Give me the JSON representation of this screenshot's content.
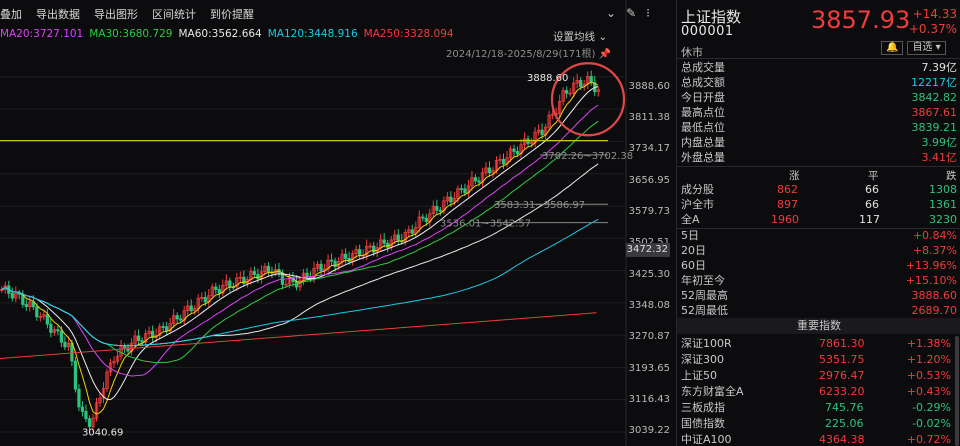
{
  "toolbar": {
    "items": [
      "叠加",
      "导出数据",
      "导出图形",
      "区间统计",
      "到价提醒"
    ]
  },
  "ma": [
    {
      "label": "MA20:3727.101",
      "color": "#e040fb"
    },
    {
      "label": "MA30:3680.729",
      "color": "#2ecc40"
    },
    {
      "label": "MA60:3562.664",
      "color": "#e8e8e8"
    },
    {
      "label": "MA120:3448.916",
      "color": "#1ec8e8"
    },
    {
      "label": "MA250:3328.094",
      "color": "#f03c3c"
    }
  ],
  "settings_label": "设置均线",
  "date_range": "2024/12/18-2025/8/29(171根)",
  "price_ticks": [
    "3888.60",
    "3811.38",
    "3734.17",
    "3656.95",
    "3579.73",
    "3502.51",
    "3425.30",
    "3348.08",
    "3270.87",
    "3193.65",
    "3116.43",
    "3039.22"
  ],
  "current_price_label": "3472.32",
  "annotations": {
    "high": "3888.60",
    "low": "3040.69",
    "range1": "3702.26~3702.38",
    "range2": "3583.31~3586.97",
    "range3": "3536.01~3542.57"
  },
  "quote": {
    "name": "上证指数",
    "code": "000001",
    "price": "3857.93",
    "change": "+14.33",
    "pct": "+0.37%",
    "status": "休市",
    "btn_self": "自选",
    "btn_bell": "🔔"
  },
  "stats": [
    {
      "label": "总成交量",
      "value": "7.39亿",
      "color": "white"
    },
    {
      "label": "总成交额",
      "value": "12217亿",
      "color": "white"
    },
    {
      "label": "今日开盘",
      "value": "3842.82",
      "color": "green"
    },
    {
      "label": "最高点位",
      "value": "3867.61",
      "color": "red"
    },
    {
      "label": "最低点位",
      "value": "3839.21",
      "color": "green"
    },
    {
      "label": "内盘总量",
      "value": "3.99亿",
      "color": "green"
    },
    {
      "label": "外盘总量",
      "value": "3.41亿",
      "color": "red"
    }
  ],
  "advance": {
    "headers": [
      "涨",
      "平",
      "跌"
    ],
    "rows": [
      {
        "label": "成分股",
        "up": "862",
        "flat": "66",
        "down": "1308"
      },
      {
        "label": "沪全市",
        "up": "897",
        "flat": "66",
        "down": "1361"
      },
      {
        "label": "全A",
        "up": "1960",
        "flat": "117",
        "down": "3230"
      }
    ]
  },
  "periods": [
    {
      "label": "5日",
      "value": "+0.84%",
      "color": "red"
    },
    {
      "label": "20日",
      "value": "+8.37%",
      "color": "red"
    },
    {
      "label": "60日",
      "value": "+13.96%",
      "color": "red"
    },
    {
      "label": "年初至今",
      "value": "+15.10%",
      "color": "red"
    },
    {
      "label": "52周最高",
      "value": "3888.60",
      "color": "red"
    },
    {
      "label": "52周最低",
      "value": "2689.70",
      "color": "red"
    }
  ],
  "indices_title": "重要指数",
  "indices": [
    {
      "name": "深证100R",
      "value": "7861.30",
      "pct": "+1.38%",
      "color": "red"
    },
    {
      "name": "深证300",
      "value": "5351.75",
      "pct": "+1.20%",
      "color": "red"
    },
    {
      "name": "上证50",
      "value": "2976.47",
      "pct": "+0.53%",
      "color": "red"
    },
    {
      "name": "东方财富全A",
      "value": "6233.20",
      "pct": "+0.43%",
      "color": "red"
    },
    {
      "name": "三板成指",
      "value": "745.76",
      "pct": "-0.29%",
      "color": "green"
    },
    {
      "name": "国债指数",
      "value": "225.06",
      "pct": "-0.02%",
      "color": "green"
    },
    {
      "name": "中证A100",
      "value": "4364.38",
      "pct": "+0.72%",
      "color": "red"
    }
  ],
  "chart_data": {
    "type": "candlestick",
    "y_range": [
      3020,
      3905
    ],
    "ma_levels": {
      "MA20": 3727.101,
      "MA30": 3680.729,
      "MA60": 3562.664,
      "MA120": 3448.916,
      "MA250": 3328.094
    },
    "high": 3888.6,
    "low": 3040.69,
    "last": 3857.93
  }
}
